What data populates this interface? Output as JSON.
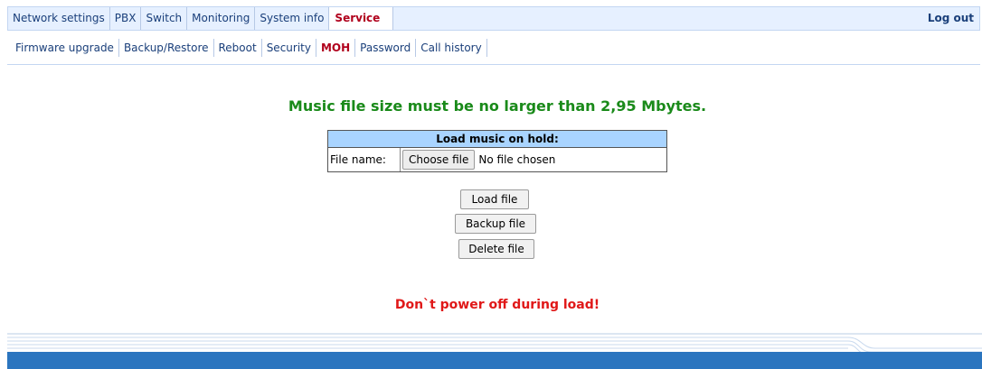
{
  "top_nav": {
    "tabs": [
      "Network settings",
      "PBX",
      "Switch",
      "Monitoring",
      "System info",
      "Service"
    ],
    "active": "Service",
    "logout": "Log out"
  },
  "sub_nav": {
    "tabs": [
      "Firmware upgrade",
      "Backup/Restore",
      "Reboot",
      "Security",
      "MOH",
      "Password",
      "Call history"
    ],
    "active": "MOH"
  },
  "main": {
    "size_notice": "Music file size must be no larger than 2,95 Mbytes.",
    "table_header": "Load music on hold:",
    "file_label": "File name:",
    "choose_file": "Choose file",
    "file_status": "No file chosen",
    "load_button": "Load file",
    "backup_button": "Backup file",
    "delete_button": "Delete file",
    "warning": "Don`t power off during load!"
  },
  "colors": {
    "notice_green": "#1a8a1a",
    "warning_red": "#e01818",
    "active_tab": "#b0001c",
    "header_blue": "#a9d4ff",
    "footer_blue": "#2b75bf"
  }
}
